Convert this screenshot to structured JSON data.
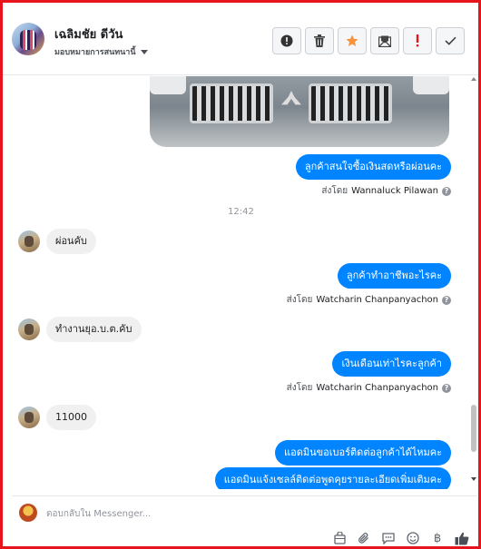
{
  "header": {
    "name": "เฉลิมชัย ดีวัน",
    "subtitle": "มอบหมายการสนทนานี้",
    "buttons": [
      {
        "name": "report-button",
        "icon": "alert-circle-icon"
      },
      {
        "name": "delete-button",
        "icon": "trash-icon"
      },
      {
        "name": "star-button",
        "icon": "star-icon",
        "color": "#f7923b"
      },
      {
        "name": "mark-unread-button",
        "icon": "envelope-icon"
      },
      {
        "name": "important-button",
        "icon": "exclamation-icon",
        "color": "#e8141b"
      },
      {
        "name": "done-button",
        "icon": "check-icon"
      }
    ]
  },
  "messages": {
    "m1": "ลูกค้าสนใจซื้อเงินสดหรือผ่อนคะ",
    "m1_sentby_prefix": "ส่งโดย",
    "m1_sender": "Wannaluck Pilawan",
    "time": "12:42",
    "m2": "ผ่อนคับ",
    "m3": "ลูกค้าทำอาชีพอะไรคะ",
    "m3_sentby_prefix": "ส่งโดย",
    "m3_sender": "Watcharin Chanpanyachon",
    "m4": "ทำงานยุอ.บ.ต.คับ",
    "m5": "เงินเดือนเท่าไรคะลูกค้า",
    "m5_sentby_prefix": "ส่งโดย",
    "m5_sender": "Watcharin Chanpanyachon",
    "m6": "11000",
    "m7": "แอดมินขอเบอร์ติดต่อลูกค้าได้ไหมคะ",
    "m8": "แอดมินแจ้งเซลล์ติดต่อพูดคุยรายละเอียดเพิ่มเติมคะ"
  },
  "composer": {
    "placeholder": "ตอบกลับใน Messenger...",
    "icons": [
      "bag-icon",
      "attachment-icon",
      "saved-replies-icon",
      "emoji-icon",
      "baht-icon",
      "like-icon"
    ]
  },
  "colors": {
    "accent": "#0084ff",
    "frame_border": "#e8141b"
  }
}
